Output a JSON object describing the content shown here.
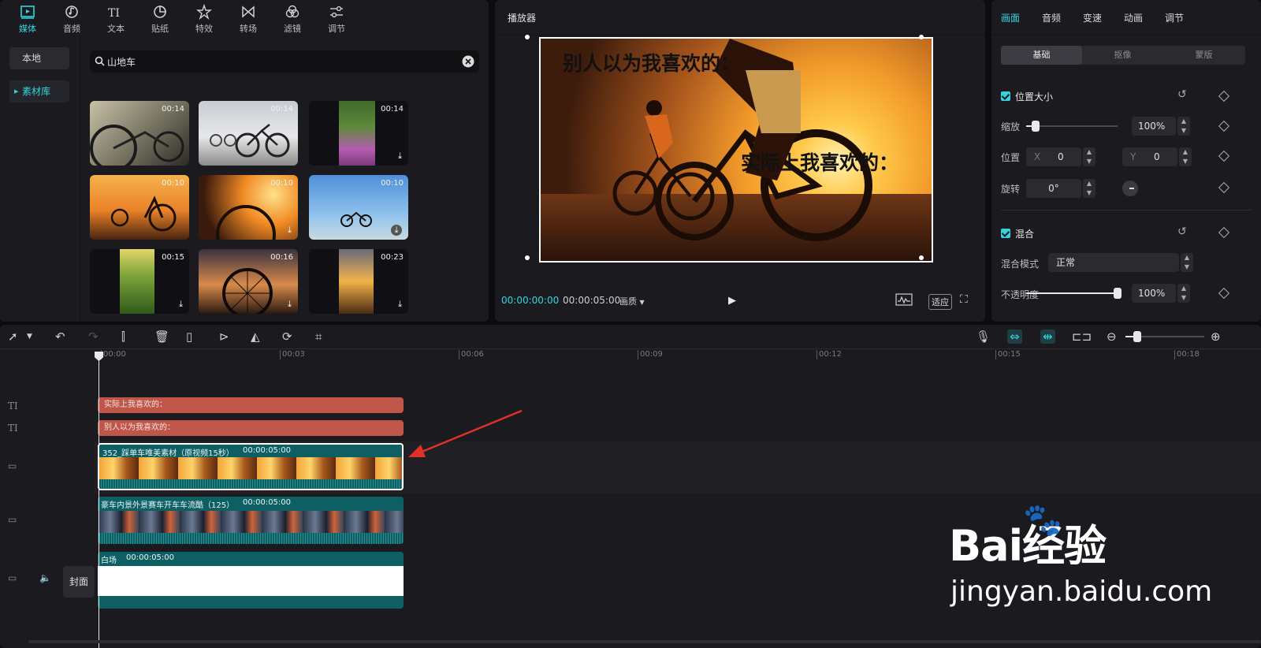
{
  "media": {
    "tabs": [
      {
        "label": "媒体",
        "icon": "media-icon"
      },
      {
        "label": "音频",
        "icon": "audio-icon"
      },
      {
        "label": "文本",
        "icon": "text-icon"
      },
      {
        "label": "贴纸",
        "icon": "sticker-icon"
      },
      {
        "label": "特效",
        "icon": "effects-icon"
      },
      {
        "label": "转场",
        "icon": "transition-icon"
      },
      {
        "label": "滤镜",
        "icon": "filter-icon"
      },
      {
        "label": "调节",
        "icon": "adjust-icon"
      }
    ],
    "side": {
      "local": "本地",
      "library": "素材库"
    },
    "search": {
      "value": "山地车"
    },
    "thumbs": [
      {
        "dur": "00:14"
      },
      {
        "dur": "00:14"
      },
      {
        "dur": "00:14"
      },
      {
        "dur": "00:10"
      },
      {
        "dur": "00:10"
      },
      {
        "dur": "00:10"
      },
      {
        "dur": "00:15"
      },
      {
        "dur": "00:16"
      },
      {
        "dur": "00:23"
      }
    ]
  },
  "player": {
    "title": "播放器",
    "caption_top": "别人以为我喜欢的：",
    "caption_mid": "实际上我喜欢的：",
    "timecode_current": "00:00:00:00",
    "timecode_total": "00:00:05:00",
    "quality": "画质",
    "fit": "适应"
  },
  "props": {
    "tabs": [
      "画面",
      "音频",
      "变速",
      "动画",
      "调节"
    ],
    "segments": [
      "基础",
      "抠像",
      "蒙版"
    ],
    "section_transform": "位置大小",
    "scale_label": "缩放",
    "scale_value": "100%",
    "scale_level": 0.1,
    "position_label": "位置",
    "x_label": "X",
    "x_value": "0",
    "y_label": "Y",
    "y_value": "0",
    "rotation_label": "旋转",
    "rotation_value": "0°",
    "section_blend": "混合",
    "blend_mode_label": "混合模式",
    "blend_mode_value": "正常",
    "opacity_label": "不透明度",
    "opacity_value": "100%",
    "opacity_level": 1.0
  },
  "timeline": {
    "ruler": [
      "00:00",
      "00:03",
      "00:06",
      "00:09",
      "00:12",
      "00:15",
      "00:18"
    ],
    "text_clip_1": "实际上我喜欢的：",
    "text_clip_2": "别人以为我喜欢的：",
    "video_clip_1": "352_踩单车唯美素材（原视频15秒）",
    "video_clip_1_dur": "00:00:05:00",
    "video_clip_2": "豪车内景外景赛车开车车流酷（125）",
    "video_clip_2_dur": "00:00:05:00",
    "video_clip_3": "白场",
    "video_clip_3_dur": "00:00:05:00",
    "cover": "封面"
  },
  "watermark": {
    "brand": "Bai经验",
    "url": "jingyan.baidu.com"
  },
  "colors": {
    "accent": "#2fd6df",
    "text_clip": "#c0564a",
    "video_clip": "#0e5f63",
    "arrow": "#e0302a"
  }
}
